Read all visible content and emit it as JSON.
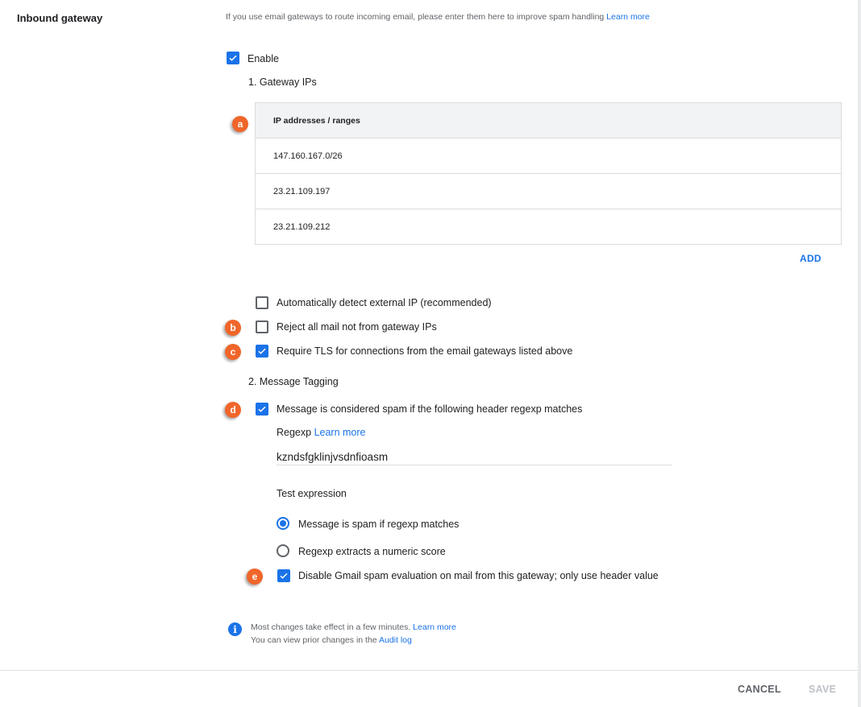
{
  "setting": {
    "title": "Inbound gateway",
    "description": "If you use email gateways to route incoming email, please enter them here to improve spam handling",
    "description_link": "Learn more"
  },
  "enable": {
    "label": "Enable",
    "checked": true
  },
  "gateway_ips": {
    "section_title": "1. Gateway IPs",
    "column_header": "IP addresses / ranges",
    "rows": [
      "147.160.167.0/26",
      "23.21.109.197",
      "23.21.109.212"
    ],
    "add_label": "ADD"
  },
  "options": {
    "auto_detect": {
      "label": "Automatically detect external IP (recommended)",
      "checked": false
    },
    "reject_non_gateway": {
      "label": "Reject all mail not from gateway IPs",
      "checked": false
    },
    "require_tls": {
      "label": "Require TLS for connections from the email gateways listed above",
      "checked": true
    }
  },
  "message_tagging": {
    "section_title": "2. Message Tagging",
    "spam_header": {
      "label": "Message is considered spam if the following header regexp matches",
      "checked": true
    },
    "regexp_label": "Regexp",
    "regexp_link": "Learn more",
    "regexp_value": "kzndsfgklinjvsdnfioasm",
    "test_expression": "Test expression",
    "radio_spam_if_matches": {
      "label": "Message is spam if regexp matches",
      "selected": true
    },
    "radio_numeric_score": {
      "label": "Regexp extracts a numeric score",
      "selected": false
    },
    "disable_gmail_eval": {
      "label": "Disable Gmail spam evaluation on mail from this gateway; only use header value",
      "checked": true
    }
  },
  "markers": {
    "a": "a",
    "b": "b",
    "c": "c",
    "d": "d",
    "e": "e"
  },
  "info": {
    "line1": "Most changes take effect in a few minutes.",
    "line1_link": "Learn more",
    "line2": "You can view prior changes in the",
    "line2_link": "Audit log"
  },
  "footer": {
    "cancel": "CANCEL",
    "save": "SAVE"
  },
  "colors": {
    "accent": "#1a73e8",
    "marker": "#f0652a"
  }
}
